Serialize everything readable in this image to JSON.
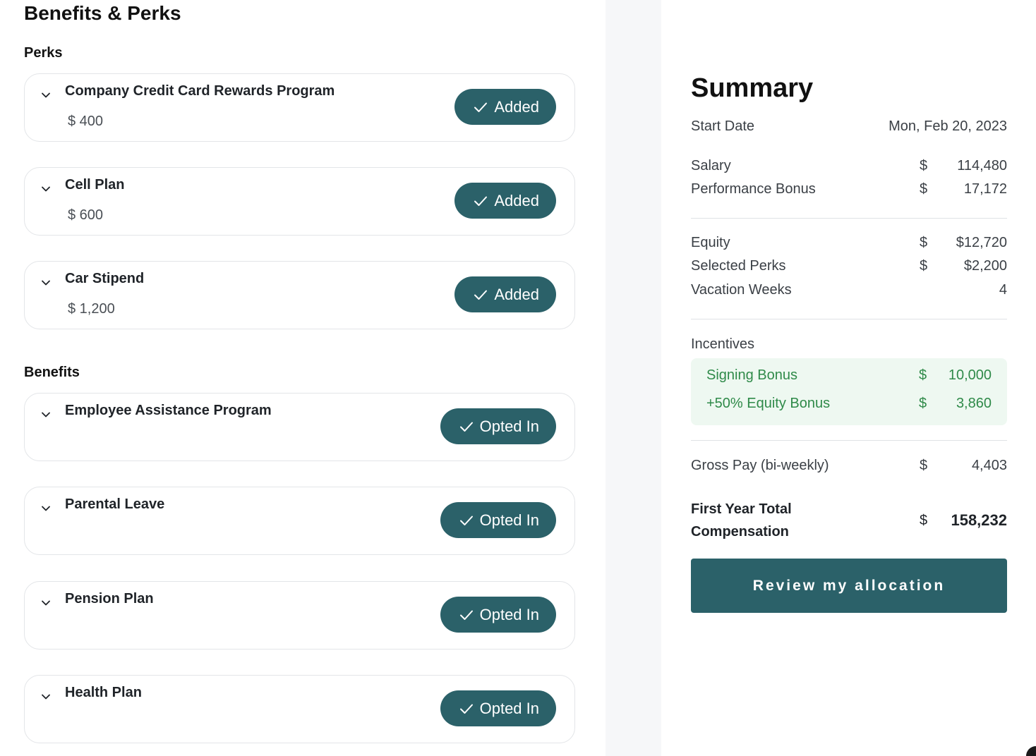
{
  "page_title": "Benefits & Perks",
  "perks": {
    "title": "Perks",
    "items": [
      {
        "name": "Company Credit Card Rewards Program",
        "amount": "$ 400",
        "status": "Added"
      },
      {
        "name": "Cell Plan",
        "amount": "$ 600",
        "status": "Added"
      },
      {
        "name": "Car Stipend",
        "amount": "$ 1,200",
        "status": "Added"
      }
    ]
  },
  "benefits": {
    "title": "Benefits",
    "items": [
      {
        "name": "Employee Assistance Program",
        "status": "Opted In"
      },
      {
        "name": "Parental Leave",
        "status": "Opted In"
      },
      {
        "name": "Pension Plan",
        "status": "Opted In"
      },
      {
        "name": "Health Plan",
        "status": "Opted In"
      }
    ]
  },
  "summary": {
    "title": "Summary",
    "start_date_label": "Start Date",
    "start_date": "Mon, Feb 20, 2023",
    "salary": {
      "label": "Salary",
      "currency": "$",
      "value": "114,480"
    },
    "performance_bonus": {
      "label": "Performance Bonus",
      "currency": "$",
      "value": "17,172"
    },
    "equity": {
      "label": "Equity",
      "currency": "$",
      "value": "$12,720"
    },
    "selected_perks": {
      "label": "Selected Perks",
      "currency": "$",
      "value": "$2,200"
    },
    "vacation_weeks": {
      "label": "Vacation Weeks",
      "value": "4"
    },
    "incentives": {
      "label": "Incentives",
      "signing_bonus": {
        "label": "Signing Bonus",
        "currency": "$",
        "value": "10,000"
      },
      "equity_bonus": {
        "label": "+50% Equity Bonus",
        "currency": "$",
        "value": "3,860"
      }
    },
    "gross_pay": {
      "label": "Gross Pay (bi-weekly)",
      "currency": "$",
      "value": "4,403"
    },
    "first_year_total": {
      "label_line1": "First Year Total",
      "label_line2": "Compensation",
      "currency": "$",
      "value": "158,232"
    },
    "review_button": "Review my allocation"
  },
  "colors": {
    "accent": "#2b6169",
    "incentive_bg": "#eef8f1",
    "incentive_text": "#2f8a49"
  }
}
